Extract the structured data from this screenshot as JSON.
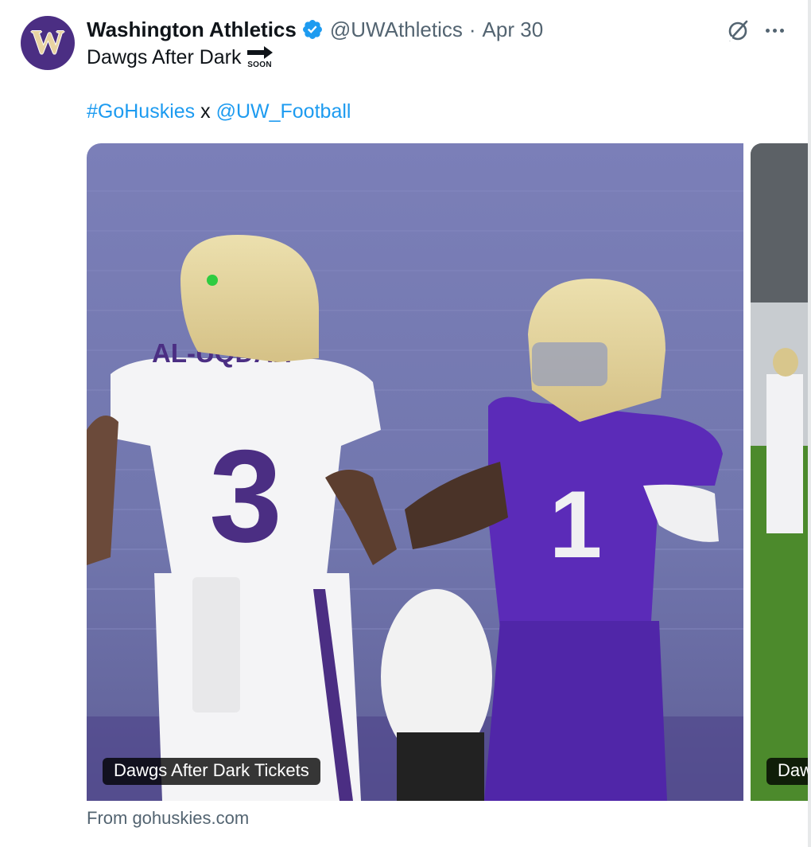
{
  "author": {
    "name": "Washington Athletics",
    "handle": "@UWAthletics",
    "separator": "·",
    "date": "Apr 30",
    "avatar_letter": "W",
    "verified": true
  },
  "tweet": {
    "line1": "Dawgs After Dark",
    "emoji_label": "SOON",
    "hashtag": "#GoHuskies",
    "joiner": " x ",
    "mention": "@UW_Football"
  },
  "media": {
    "card_label": "Dawgs After Dark Tickets",
    "second_card_label": "Dawgs After Dark Tickets",
    "player_left_name": "AL-UQDAH",
    "player_left_number": "3",
    "player_right_number": "1",
    "source": "From gohuskies.com"
  },
  "icons": {
    "verified": "verified-badge-icon",
    "grok": "grok-icon",
    "more": "more-options-icon",
    "soon_arrow": "soon-arrow-icon"
  },
  "colors": {
    "link": "#1d9bf0",
    "brand_purple": "#4b2e83",
    "gold": "#e8d3a2"
  }
}
